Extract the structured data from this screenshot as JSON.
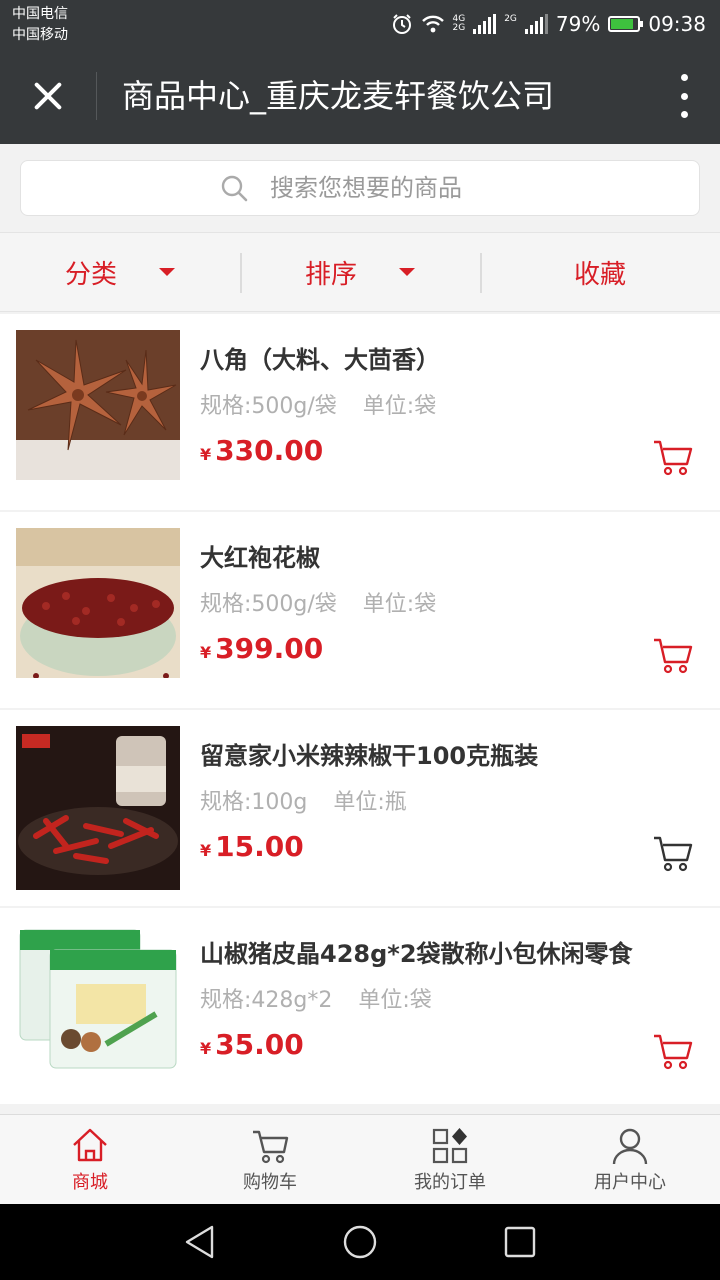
{
  "status_bar": {
    "carrier_1": "中国电信",
    "carrier_2": "中国移动",
    "net_label_1a": "4G",
    "net_label_1b": "2G",
    "net_label_2": "2G",
    "battery": "79%",
    "battery_level": 0.79,
    "time": "09:38"
  },
  "header": {
    "title": "商品中心_重庆龙麦轩餐饮公司"
  },
  "search": {
    "placeholder": "搜索您想要的商品"
  },
  "filters": {
    "category": "分类",
    "sort": "排序",
    "favorite": "收藏"
  },
  "products": [
    {
      "name": "八角（大料、大茴香）",
      "spec": "规格:500g/袋",
      "unit": "单位:袋",
      "currency": "¥",
      "price": "330.00"
    },
    {
      "name": "大红袍花椒",
      "spec": "规格:500g/袋",
      "unit": "单位:袋",
      "currency": "¥",
      "price": "399.00"
    },
    {
      "name": "留意家小米辣辣椒干100克瓶装",
      "spec": "规格:100g",
      "unit": "单位:瓶",
      "currency": "¥",
      "price": "15.00"
    },
    {
      "name": "山椒猪皮晶428g*2袋散称小包休闲零食",
      "spec": "规格:428g*2",
      "unit": "单位:袋",
      "currency": "¥",
      "price": "35.00"
    }
  ],
  "bottom_nav": [
    {
      "label": "商城",
      "icon": "home-icon"
    },
    {
      "label": "购物车",
      "icon": "cart-icon"
    },
    {
      "label": "我的订单",
      "icon": "orders-icon"
    },
    {
      "label": "用户中心",
      "icon": "user-icon"
    }
  ],
  "colors": {
    "accent": "#d81e26",
    "title_bar": "#36393b"
  }
}
